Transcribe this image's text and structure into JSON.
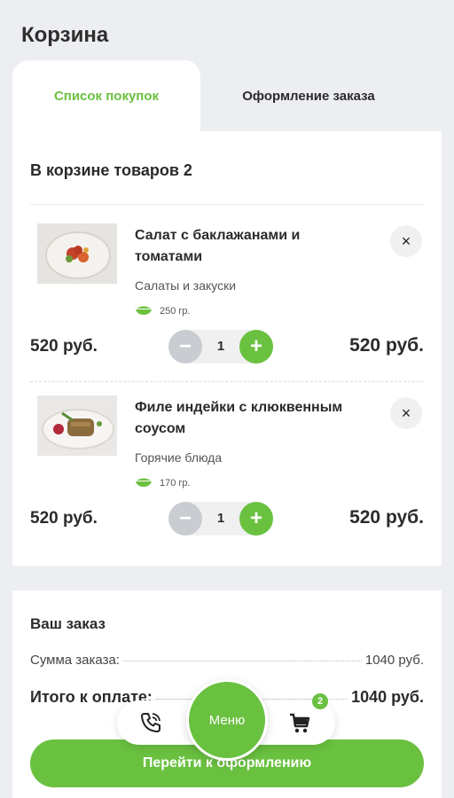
{
  "header": {
    "title": "Корзина"
  },
  "tabs": [
    {
      "label": "Список покупок",
      "active": true
    },
    {
      "label": "Оформление заказа",
      "active": false
    }
  ],
  "cart": {
    "count_label": "В корзине товаров 2",
    "items": [
      {
        "name": "Салат с баклажанами и томатами",
        "category": "Салаты и закуски",
        "weight": "250 гр.",
        "unit_price": "520 руб.",
        "quantity": "1",
        "total": "520 руб."
      },
      {
        "name": "Филе индейки с клюквенным соусом",
        "category": "Горячие блюда",
        "weight": "170 гр.",
        "unit_price": "520 руб.",
        "quantity": "1",
        "total": "520 руб."
      }
    ],
    "minus_symbol": "−",
    "plus_symbol": "+",
    "remove_symbol": "×"
  },
  "order": {
    "title": "Ваш заказ",
    "sum_label": "Сумма заказа:",
    "sum_value": "1040 руб.",
    "total_label": "Итого к оплате:",
    "total_value": "1040 руб."
  },
  "nav": {
    "menu_label": "Меню",
    "cart_badge": "2",
    "icons": [
      "phone-icon",
      "cart-icon"
    ]
  },
  "checkout": {
    "label": "Перейти к оформлению"
  },
  "colors": {
    "accent": "#6ac140",
    "background": "#eceef1"
  }
}
